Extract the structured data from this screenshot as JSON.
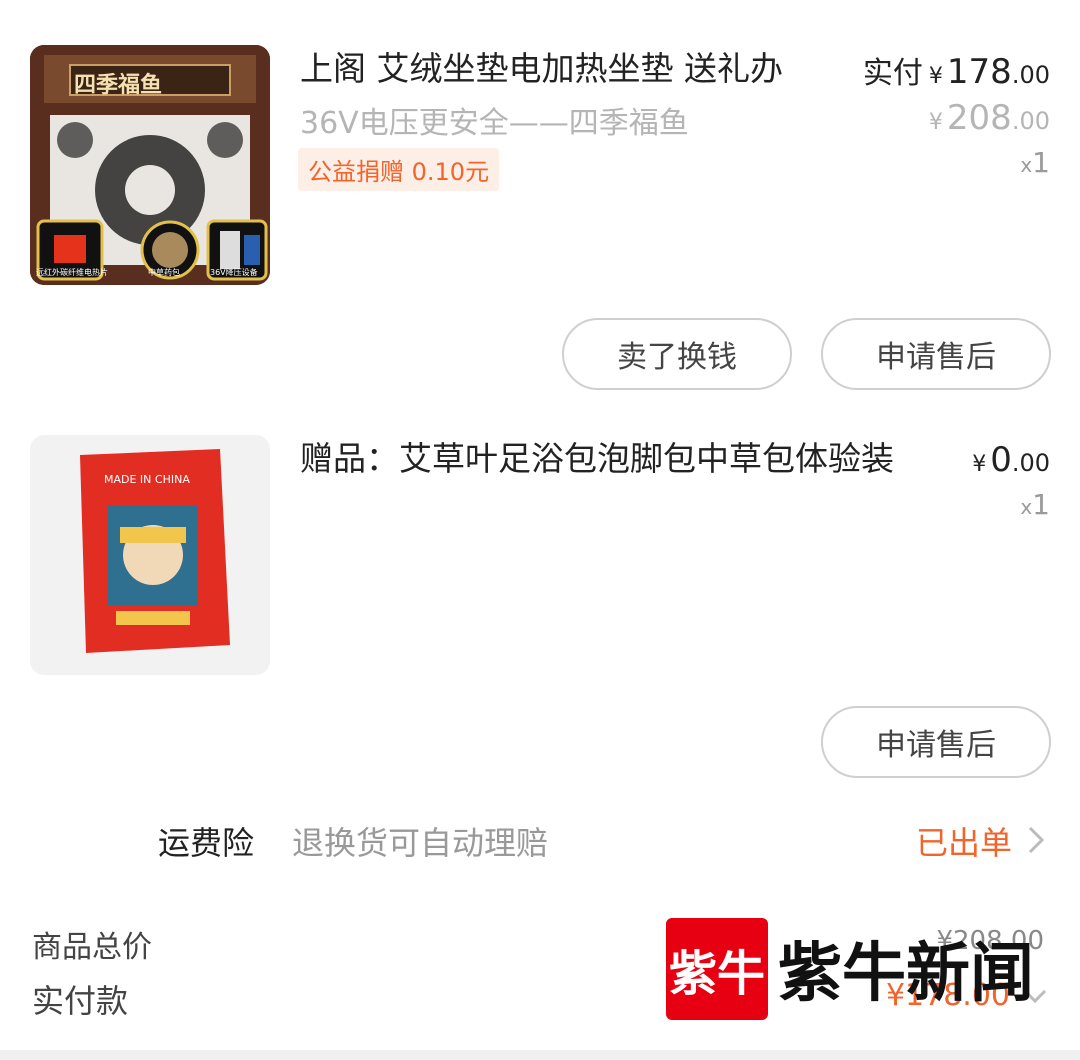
{
  "items": [
    {
      "title": "上阁 艾绒坐垫电加热坐垫 送礼办",
      "subtitle": "36V电压更安全——四季福鱼",
      "tag": "公益捐赠 0.10元",
      "paid_label": "实付",
      "currency": "¥",
      "price_int": "178",
      "price_dec": ".00",
      "orig_int": "208",
      "orig_dec": ".00",
      "qty_x": "x",
      "qty": "1",
      "thumb": {
        "banner": "四季福鱼",
        "badge1": "远红外碳纤维电热片",
        "badge2": "中草药包",
        "badge3": "36V降压设备"
      },
      "buttons": [
        "卖了换钱",
        "申请售后"
      ]
    },
    {
      "title": "赠品：艾草叶足浴包泡脚包中草包体验装",
      "currency": "¥",
      "price_int": "0",
      "price_dec": ".00",
      "qty_x": "x",
      "qty": "1",
      "thumb": {
        "made_in": "MADE IN CHINA"
      },
      "buttons": [
        "申请售后"
      ]
    }
  ],
  "insurance": {
    "label": "运费险",
    "desc": "退换货可自动理赔",
    "status": "已出单"
  },
  "summary": {
    "total_label": "商品总价",
    "total_value": "¥208.00",
    "paid_label": "实付款",
    "paid_value": "¥178.00"
  },
  "watermark": {
    "logo_mark": "紫牛",
    "logo_text": "紫牛新闻"
  },
  "colors": {
    "accent": "#f2642b",
    "logo_red": "#e60012",
    "muted": "#b5b5b5"
  }
}
